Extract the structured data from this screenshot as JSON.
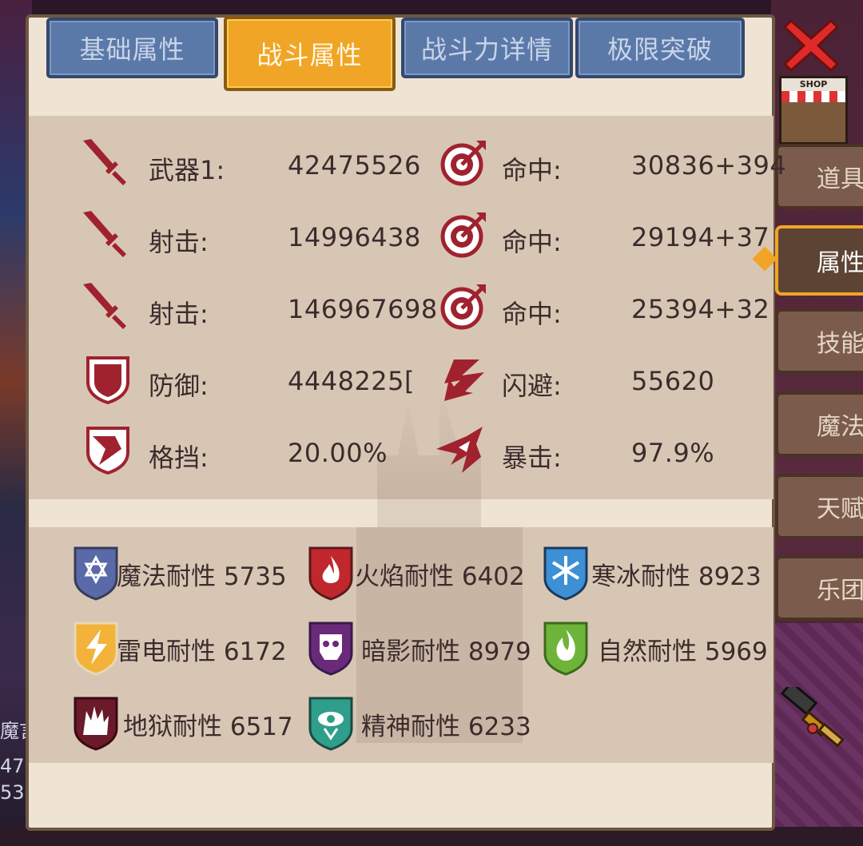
{
  "tabs": [
    {
      "label": "基础属性",
      "active": false
    },
    {
      "label": "战斗属性",
      "active": true
    },
    {
      "label": "战斗力详情",
      "active": false
    },
    {
      "label": "极限突破",
      "active": false
    }
  ],
  "side_tabs": [
    {
      "label": "道具",
      "active": false
    },
    {
      "label": "属性",
      "active": true
    },
    {
      "label": "技能",
      "active": false
    },
    {
      "label": "魔法",
      "active": false
    },
    {
      "label": "天赋",
      "active": false
    },
    {
      "label": "乐团",
      "active": false
    }
  ],
  "shop_sign": "SHOP",
  "background": {
    "left_text_1": "魔言",
    "left_text_2": "47",
    "left_text_3": "53"
  },
  "combat_stats": {
    "left": [
      {
        "icon": "sword-icon",
        "label": "武器1:",
        "value": "42475526"
      },
      {
        "icon": "sword-icon",
        "label": "射击:",
        "value": "14996438"
      },
      {
        "icon": "sword-icon",
        "label": "射击:",
        "value": "146967698"
      },
      {
        "icon": "shield-icon",
        "label": "防御:",
        "value": "4448225["
      },
      {
        "icon": "block-icon",
        "label": "格挡:",
        "value": "20.00%"
      }
    ],
    "right": [
      {
        "icon": "target-icon",
        "label": "命中:",
        "value": "30836+394"
      },
      {
        "icon": "target-icon",
        "label": "命中:",
        "value": "29194+37"
      },
      {
        "icon": "target-icon",
        "label": "命中:",
        "value": "25394+32"
      },
      {
        "icon": "dodge-icon",
        "label": "闪避:",
        "value": "55620"
      },
      {
        "icon": "critical-icon",
        "label": "暴击:",
        "value": "97.9%"
      }
    ]
  },
  "resistances": [
    {
      "icon": "magic-resist-icon",
      "text": "魔法耐性 5735",
      "color": "#5a6aa8"
    },
    {
      "icon": "fire-resist-icon",
      "text": "火焰耐性 6402",
      "color": "#c0282e"
    },
    {
      "icon": "ice-resist-icon",
      "text": "寒冰耐性 8923",
      "color": "#3d8fd6"
    },
    {
      "icon": "thunder-resist-icon",
      "text": "雷电耐性 6172",
      "color": "#f3b33a"
    },
    {
      "icon": "shadow-resist-icon",
      "text": "暗影耐性 8979",
      "color": "#6a2a7a"
    },
    {
      "icon": "nature-resist-icon",
      "text": "自然耐性 5969",
      "color": "#6fb43a"
    },
    {
      "icon": "hell-resist-icon",
      "text": "地狱耐性 6517",
      "color": "#6a1a2a"
    },
    {
      "icon": "spirit-resist-icon",
      "text": "精神耐性 6233",
      "color": "#2f9e8a"
    }
  ],
  "colors": {
    "accent": "#f0a526",
    "tab_inactive": "#5b79a8",
    "panel": "#efe4d3",
    "panel_inner": "#d8c6b5",
    "stat_icon": "#a0222f"
  }
}
